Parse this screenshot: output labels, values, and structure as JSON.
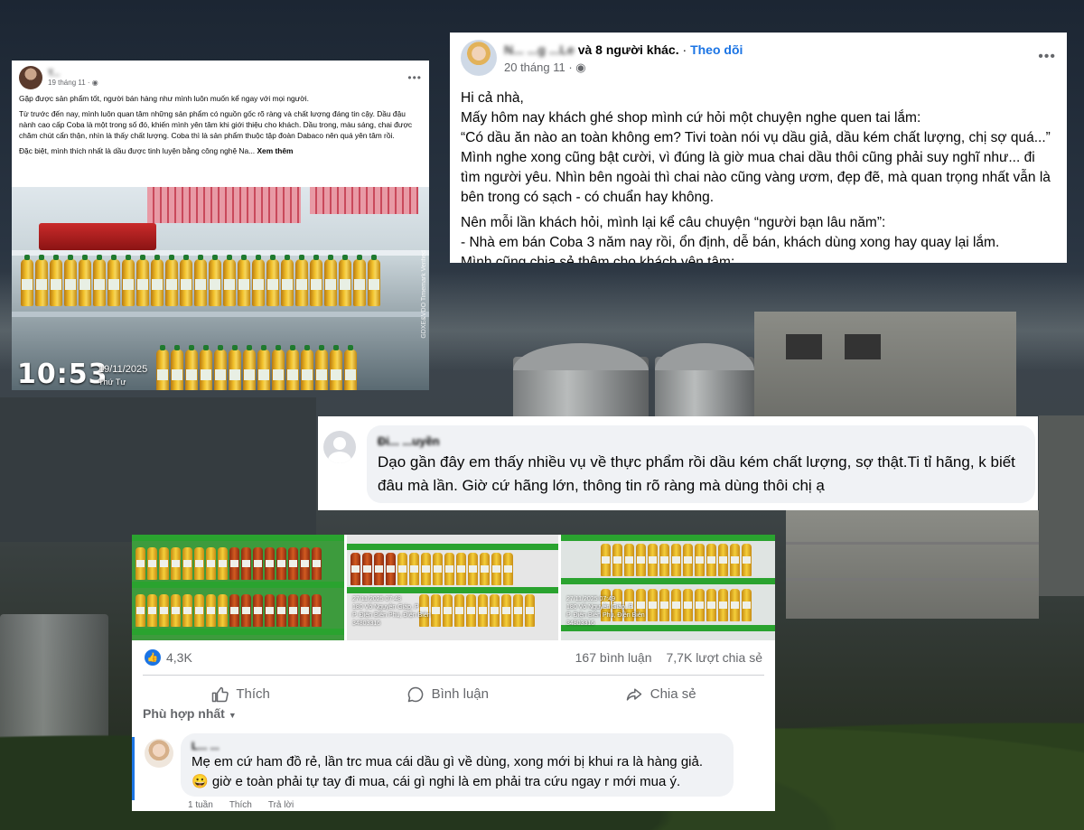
{
  "post1": {
    "author": "T...",
    "time": "19 tháng 11",
    "paragraphs": [
      "Gặp được sản phẩm tốt, người bán hàng như mình luôn muốn kể ngay với mọi người.",
      "Từ trước đến nay, mình luôn quan tâm những sản phẩm có nguồn gốc rõ ràng và chất lượng đáng tin cậy. Dầu đậu nành cao cấp Coba là một trong số đó, khiến mình yên tâm khi giới thiệu cho khách. Dầu trong, màu sáng, chai được chăm chút cẩn thận, nhìn là thấy chất lượng. Coba thì là sản phẩm thuộc tập đoàn Dabaco nên quá yên tâm rồi."
    ],
    "last_line": "Đặc biệt, mình thích nhất là dầu được tinh luyện bằng công nghệ Na...",
    "see_more": "Xem thêm",
    "photo_time": "10:53",
    "photo_date": "19/11/2025",
    "photo_day": "Thứ Tư",
    "photo_watermark": "GDXE&VDO Timemark Verified"
  },
  "post2": {
    "author_blur": "N... ...g ...Le",
    "and_others": "và 8 người khác.",
    "follow": "Theo dõi",
    "time": "20 tháng 11",
    "paragraphs": [
      "Hi cả nhà,",
      "Mấy hôm nay khách ghé shop mình cứ hỏi một chuyện nghe quen tai lắm:",
      " “Có dầu ăn nào an toàn không em? Tivi toàn nói vụ dầu giả, dầu kém chất lượng, chị sợ quá...”",
      "Mình nghe xong cũng bật cười, vì đúng là giờ mua chai dầu thôi cũng phải suy nghĩ như... đi tìm người yêu. Nhìn bên ngoài thì chai nào cũng vàng ươm, đẹp đẽ, mà quan trọng nhất vẫn là bên trong có sạch - có chuẩn hay không."
    ],
    "paragraph2": [
      "Nên mỗi lần khách hỏi, mình lại kể câu chuyện “người bạn lâu năm”:",
      " -  Nhà em bán Coba 3 năm nay rồi, ổn định, dễ bán, khách dùng xong hay quay lại lắm.",
      "Mình cũng chia sẻ thêm cho khách yên tâm:"
    ]
  },
  "comment1": {
    "name": "Đi... ...uyền",
    "text": "Dạo gần đây em thấy nhiều vụ về thực phẩm rồi dầu kém chất lượng, sợ thật.Ti tỉ hãng, k biết đâu mà lần. Giờ cứ hãng lớn, thông tin rõ ràng mà dùng thôi chị ạ"
  },
  "post3": {
    "photo_stamp": "27/11/2025 07:48\n180 Võ Nguyên Giáp, P\nP. Điện Biên Phủ, Điện Biên\n34803316",
    "photo_stamp_b": "27/11/2025 07:49\n180 Võ Nguyên Giáp, P\nP. Điện Biên Phủ, Điện Biên\n34803316",
    "likes": "4,3K",
    "comments": "167 bình luận",
    "shares": "7,7K lượt chia sẻ",
    "action_like": "Thích",
    "action_comment": "Bình luận",
    "action_share": "Chia sẻ",
    "sort_label": "Phù hợp nhất",
    "comment": {
      "name": "L... ...",
      "text": "Mẹ em cứ ham đồ rẻ, lần trc mua cái dầu gì về dùng, xong mới bị khui ra là hàng giả. 😀 giờ e toàn phải tự tay đi mua, cái gì nghi là em phải tra cứu ngay r mới mua ý.",
      "meta_time": "1 tuần",
      "meta_like": "Thích",
      "meta_reply": "Trả lời"
    }
  },
  "colors": {
    "accent": "#1b74e4",
    "bubble": "#f0f2f5",
    "muted": "#65676b"
  }
}
